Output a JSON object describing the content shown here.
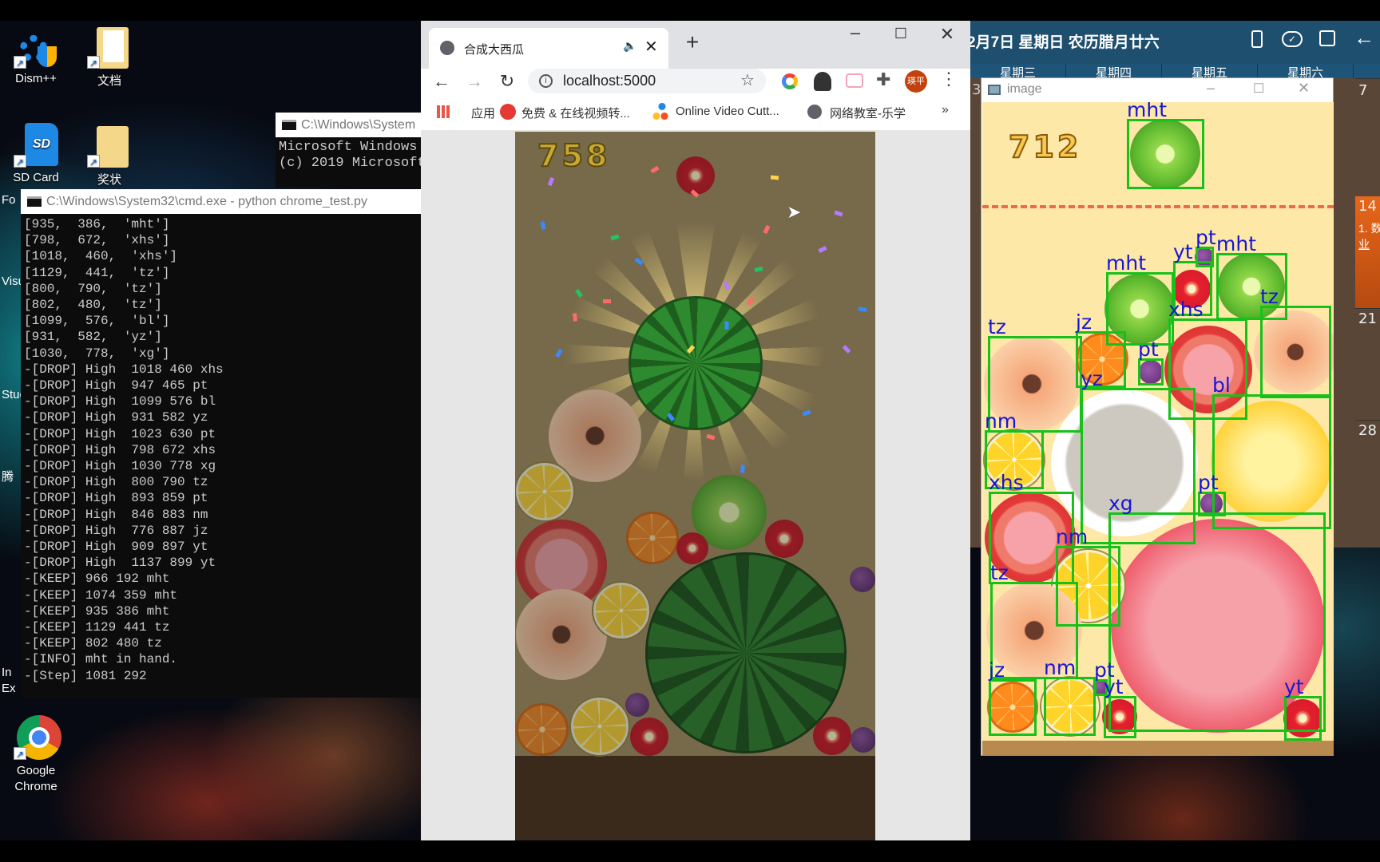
{
  "desktop": {
    "icons": [
      {
        "label": "Dism++"
      },
      {
        "label": "文档"
      },
      {
        "label": "SD Card"
      },
      {
        "label": "奖状"
      },
      {
        "label": "Google Chrome"
      }
    ],
    "partial_labels": [
      "Fo",
      "Visu",
      "Stuc",
      "腾",
      "In",
      "Ex"
    ]
  },
  "cmd_back": {
    "title": "C:\\Windows\\System",
    "lines": [
      "Microsoft Windows",
      "(c) 2019 Microsoft"
    ]
  },
  "cmd": {
    "title": "C:\\Windows\\System32\\cmd.exe - python  chrome_test.py",
    "lines": [
      "[935,  386,  'mht']",
      "[798,  672,  'xhs']",
      "[1018,  460,  'xhs']",
      "[1129,  441,  'tz']",
      "[800,  790,  'tz']",
      "[802,  480,  'tz']",
      "[1099,  576,  'bl']",
      "[931,  582,  'yz']",
      "[1030,  778,  'xg']",
      "-[DROP] High  1018 460 xhs",
      "-[DROP] High  947 465 pt",
      "-[DROP] High  1099 576 bl",
      "-[DROP] High  931 582 yz",
      "-[DROP] High  1023 630 pt",
      "-[DROP] High  798 672 xhs",
      "-[DROP] High  1030 778 xg",
      "-[DROP] High  800 790 tz",
      "-[DROP] High  893 859 pt",
      "-[DROP] High  846 883 nm",
      "-[DROP] High  776 887 jz",
      "-[DROP] High  909 897 yt",
      "-[DROP] High  1137 899 yt",
      "-[KEEP] 966 192 mht",
      "-[KEEP] 1074 359 mht",
      "-[KEEP] 935 386 mht",
      "-[KEEP] 1129 441 tz",
      "-[KEEP] 802 480 tz",
      "-[INFO] mht in hand.",
      "-[Step] 1081 292"
    ]
  },
  "chrome": {
    "tab_title": "合成大西瓜",
    "url": "localhost:5000",
    "profile_initials": "瑛平",
    "bookmarks": [
      {
        "label": "应用",
        "icon": "apps-grid-icon"
      },
      {
        "label": "免费 & 在线视频转...",
        "icon": "convert-icon"
      },
      {
        "label": "Online Video Cutt...",
        "icon": "dots-icon"
      },
      {
        "label": "网络教室-乐学",
        "icon": "globe-icon"
      }
    ],
    "more_bookmarks": "»"
  },
  "game": {
    "score": "758"
  },
  "image_window": {
    "title": "image",
    "score": "712",
    "detections": [
      "mht",
      "mht",
      "yt",
      "pt",
      "mht",
      "tz",
      "xhs",
      "tz",
      "jz",
      "pt",
      "yz",
      "bl",
      "nm",
      "pt",
      "xg",
      "xhs",
      "nm",
      "tz",
      "jz",
      "nm",
      "pt",
      "yt",
      "yt"
    ]
  },
  "calendar": {
    "header": "2月7日 星期日 农历腊月廿六",
    "weekdays": [
      "星期三",
      "星期四",
      "星期五",
      "星期六"
    ],
    "days": [
      "7",
      "14",
      "21",
      "28",
      "3"
    ],
    "event_text": "1. 数",
    "event_text2": "业"
  },
  "colors": {
    "detection_box": "#16c21a",
    "detection_label": "#1616d8",
    "calendar_header": "#1e4f6e"
  }
}
